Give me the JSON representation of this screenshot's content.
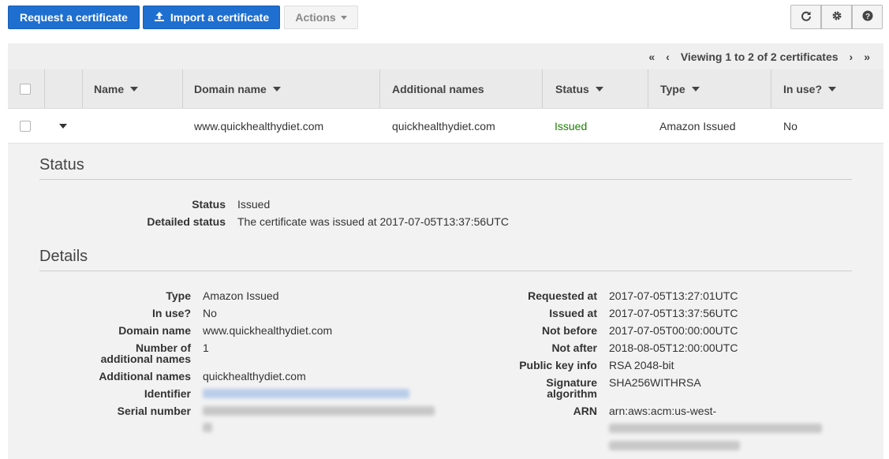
{
  "toolbar": {
    "request_label": "Request a certificate",
    "import_label": "Import a certificate",
    "actions_label": "Actions",
    "icons": [
      "refresh-icon",
      "gear-icon",
      "help-icon"
    ]
  },
  "pager": {
    "first": "«",
    "prev": "‹",
    "text": "Viewing 1 to 2 of 2 certificates",
    "next": "›",
    "last": "»"
  },
  "table": {
    "columns": [
      "Name",
      "Domain name",
      "Additional names",
      "Status",
      "Type",
      "In use?"
    ],
    "row": {
      "name": "",
      "domain": "www.quickhealthydiet.com",
      "additional": "quickhealthydiet.com",
      "status": "Issued",
      "type": "Amazon Issued",
      "in_use": "No"
    }
  },
  "colors": {
    "primary": "#1e6fd0",
    "status_issued": "#1d8102"
  },
  "status_section": {
    "title": "Status",
    "status_label": "Status",
    "status_value": "Issued",
    "detailed_label": "Detailed status",
    "detailed_value": "The certificate was issued at 2017-07-05T13:37:56UTC"
  },
  "details_section": {
    "title": "Details",
    "left": {
      "type_label": "Type",
      "type_value": "Amazon Issued",
      "inuse_label": "In use?",
      "inuse_value": "No",
      "domain_label": "Domain name",
      "domain_value": "www.quickhealthydiet.com",
      "num_label_1": "Number of",
      "num_label_2": "additional names",
      "num_value": "1",
      "addl_label": "Additional names",
      "addl_value": "quickhealthydiet.com",
      "identifier_label": "Identifier",
      "serial_label": "Serial number"
    },
    "right": {
      "requested_label": "Requested at",
      "requested_value": "2017-07-05T13:27:01UTC",
      "issued_label": "Issued at",
      "issued_value": "2017-07-05T13:37:56UTC",
      "notbefore_label": "Not before",
      "notbefore_value": "2017-07-05T00:00:00UTC",
      "notafter_label": "Not after",
      "notafter_value": "2018-08-05T12:00:00UTC",
      "pubkey_label": "Public key info",
      "pubkey_value": "RSA 2048-bit",
      "sig_label_1": "Signature",
      "sig_label_2": "algorithm",
      "sig_value": "SHA256WITHRSA",
      "arn_label": "ARN",
      "arn_value": "arn:aws:acm:us-west-"
    }
  }
}
